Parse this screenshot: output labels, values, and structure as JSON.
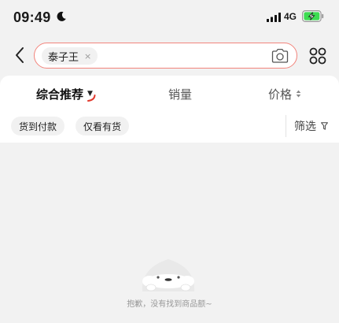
{
  "status_bar": {
    "time": "09:49",
    "network": "4G",
    "icons": [
      "moon-icon",
      "signal-icon",
      "battery-charging-icon"
    ]
  },
  "search": {
    "back_icon": "chevron-left-icon",
    "query_chip": "泰子王",
    "chip_close": "×",
    "camera_icon": "camera-icon",
    "more_icon": "grid-dots-icon"
  },
  "sort_bar": {
    "composite": "综合推荐",
    "sales": "销量",
    "price": "价格"
  },
  "quick_filters": {
    "cod": "货到付款",
    "in_stock": "仅看有货",
    "filter": "筛选"
  },
  "empty_state": {
    "message": "抱歉，没有找到商品额~"
  },
  "colors": {
    "accent": "#f2847c",
    "active_text": "#111111",
    "background": "#f2f2f2",
    "battery_fill": "#3ddc52"
  }
}
